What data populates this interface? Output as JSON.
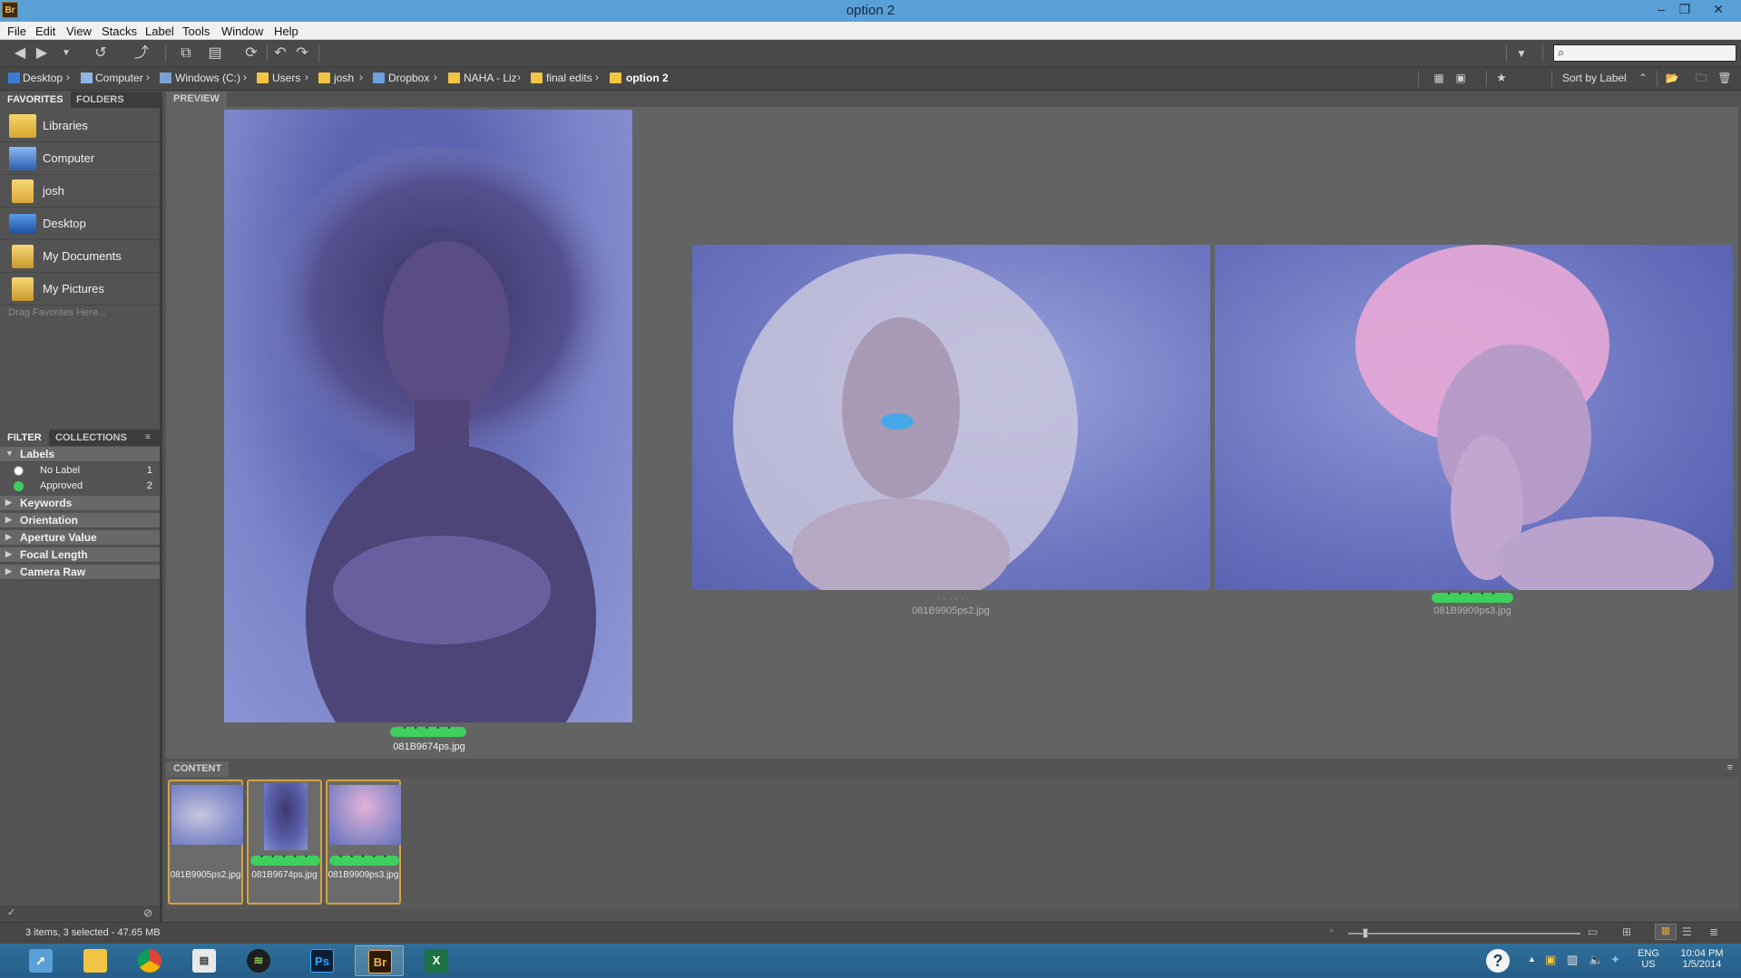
{
  "window": {
    "title": "option 2",
    "app_icon": "Br"
  },
  "menu": [
    "File",
    "Edit",
    "View",
    "Stacks",
    "Label",
    "Tools",
    "Window",
    "Help"
  ],
  "breadcrumb": [
    "Desktop",
    "Computer",
    "Windows (C:)",
    "Users",
    "josh",
    "Dropbox",
    "NAHA - Liz",
    "final edits",
    "option 2"
  ],
  "search": {
    "placeholder": ""
  },
  "sort": {
    "label": "Sort by Label"
  },
  "left_tabs": {
    "favorites": "FAVORITES",
    "folders": "FOLDERS"
  },
  "favorites": [
    {
      "label": "Libraries",
      "icon": "libraries-icon"
    },
    {
      "label": "Computer",
      "icon": "computer-icon"
    },
    {
      "label": "josh",
      "icon": "user-folder-icon"
    },
    {
      "label": "Desktop",
      "icon": "desktop-icon"
    },
    {
      "label": "My Documents",
      "icon": "documents-icon"
    },
    {
      "label": "My Pictures",
      "icon": "pictures-icon"
    }
  ],
  "favorites_hint": "Drag Favorites Here...",
  "filter_tabs": {
    "filter": "FILTER",
    "collections": "COLLECTIONS"
  },
  "filters": {
    "labels_head": "Labels",
    "labels": [
      {
        "label": "No Label",
        "count": "1",
        "color": "#ffffff"
      },
      {
        "label": "Approved",
        "count": "2",
        "color": "#3ecf5e"
      }
    ],
    "groups": [
      "Keywords",
      "Orientation",
      "Aperture Value",
      "Focal Length",
      "Camera Raw"
    ]
  },
  "preview": {
    "tab": "PREVIEW",
    "images": [
      {
        "file": "081B9674ps.jpg",
        "approved": true
      },
      {
        "file": "081B9905ps2.jpg",
        "approved": false
      },
      {
        "file": "081B9909ps3.jpg",
        "approved": true
      }
    ]
  },
  "content": {
    "tab": "CONTENT",
    "thumbs": [
      {
        "file": "081B9905ps2.jpg",
        "approved": false
      },
      {
        "file": "081B9674ps.jpg",
        "approved": true
      },
      {
        "file": "081B9909ps3.jpg",
        "approved": true
      }
    ]
  },
  "status": {
    "text": "3 items, 3 selected - 47.65 MB"
  },
  "taskbar": {
    "apps": [
      "rocket-app-icon",
      "file-explorer-icon",
      "chrome-icon",
      "news-app-icon",
      "spotify-icon",
      "photoshop-icon",
      "bridge-icon",
      "excel-icon"
    ],
    "ps_label": "Ps",
    "br_label": "Br",
    "lang_top": "ENG",
    "lang_bottom": "US",
    "time": "10:04 PM",
    "date": "1/5/2014"
  },
  "colors": {
    "approved": "#3ecf5e",
    "selection": "#d4a340",
    "titlebar": "#5aa0d8"
  }
}
